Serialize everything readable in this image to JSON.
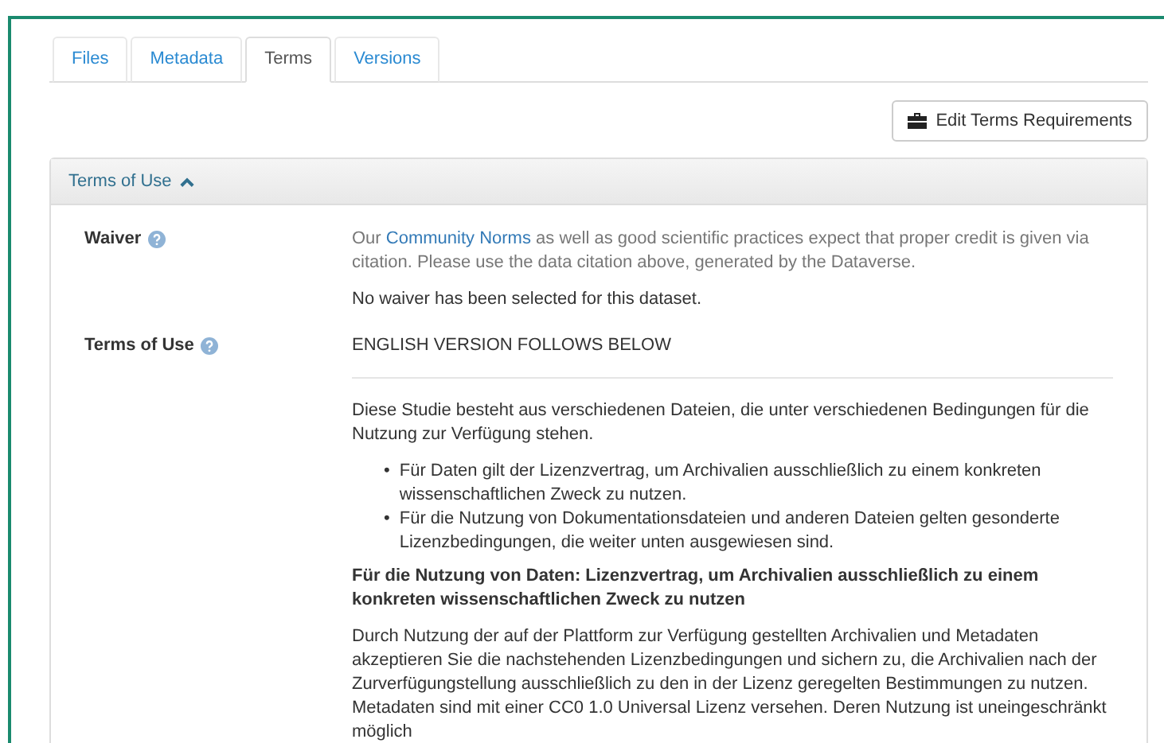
{
  "tabs": [
    {
      "label": "Files",
      "selected": false
    },
    {
      "label": "Metadata",
      "selected": false
    },
    {
      "label": "Terms",
      "selected": true
    },
    {
      "label": "Versions",
      "selected": false
    }
  ],
  "edit_button": {
    "label": "Edit Terms Requirements"
  },
  "panel": {
    "title": "Terms of Use",
    "expanded": true
  },
  "waiver": {
    "label": "Waiver",
    "text_before": "Our ",
    "link": "Community Norms",
    "text_after": " as well as good scientific practices expect that proper credit is given via citation. Please use the data citation above, generated by the Dataverse.",
    "note": "No waiver has been selected for this dataset."
  },
  "terms": {
    "label": "Terms of Use",
    "intro": "ENGLISH VERSION FOLLOWS BELOW",
    "paragraph": "Diese Studie besteht aus verschiedenen Dateien, die unter verschiedenen Bedingungen für die Nutzung zur Verfügung stehen.",
    "bullets": [
      {
        "marker": "•",
        "text": "Für Daten gilt der Lizenzvertrag, um Archivalien ausschließlich zu einem konkreten wissenschaftlichen Zweck zu nutzen."
      },
      {
        "marker": "•",
        "text": "Für die Nutzung von Dokumentationsdateien und anderen Dateien gelten gesonderte Lizenzbedingungen, die weiter unten ausgewiesen sind."
      }
    ],
    "heading": "Für die Nutzung von Daten: Lizenzvertrag, um Archivalien ausschließlich zu einem konkreten wissenschaftlichen Zweck zu nutzen",
    "body": "Durch Nutzung der auf der Plattform zur Verfügung gestellten Archivalien und Metadaten akzeptieren Sie die nachstehenden Lizenzbedingungen und sichern zu, die Archivalien nach der Zurverfügungstellung ausschließlich zu den in der Lizenz geregelten Bestimmungen zu nutzen. Metadaten sind mit einer CC0 1.0 Universal Lizenz versehen. Deren Nutzung ist uneingeschränkt möglich"
  }
}
